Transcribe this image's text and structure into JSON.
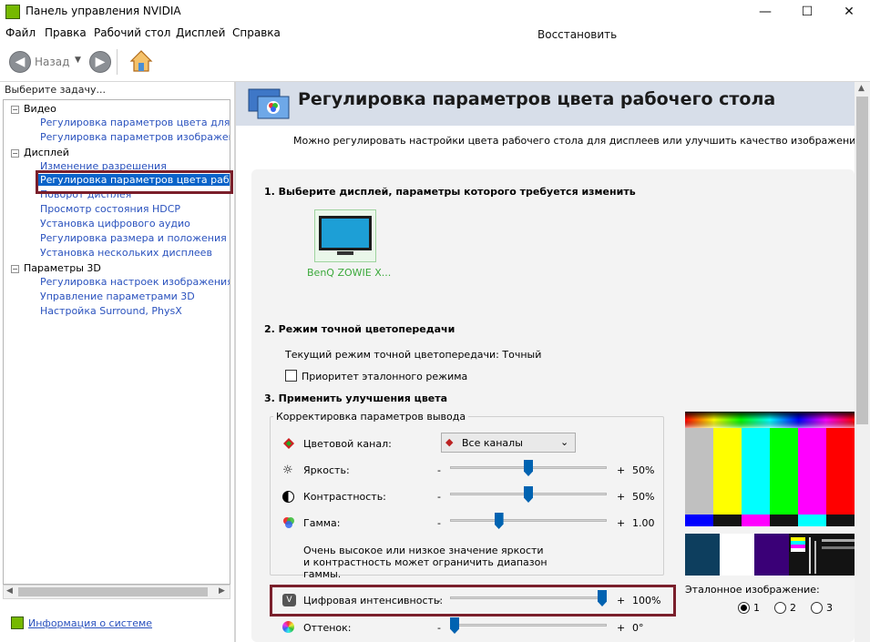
{
  "window": {
    "title": "Панель управления NVIDIA",
    "minimize": "—",
    "maximize": "☐",
    "close": "✕"
  },
  "menu": [
    "Файл",
    "Правка",
    "Рабочий стол",
    "Дисплей",
    "Справка"
  ],
  "toolbar": {
    "back_label": "Назад"
  },
  "left": {
    "header": "Выберите задачу...",
    "tree": {
      "video": {
        "label": "Видео",
        "items": [
          "Регулировка параметров цвета для вид",
          "Регулировка параметров изображения д"
        ]
      },
      "display": {
        "label": "Дисплей",
        "items": [
          "Изменение разрешения",
          "Регулировка параметров цвета рабочег",
          "Поворот дисплея",
          "Просмотр состояния HDCP",
          "Установка цифрового аудио",
          "Регулировка размера и положения рабо",
          "Установка нескольких дисплеев"
        ]
      },
      "p3d": {
        "label": "Параметры 3D",
        "items": [
          "Регулировка настроек изображения с пр",
          "Управление параметрами 3D",
          "Настройка Surround, PhysX"
        ]
      }
    },
    "system_info": "Информация о системе"
  },
  "page": {
    "title": "Регулировка параметров цвета рабочего стола",
    "restore": "Восстановить",
    "description": "Можно регулировать настройки цвета рабочего стола для дисплеев или улучшить качество изображения, если использу",
    "section1": "1. Выберите дисплей, параметры которого требуется изменить",
    "display_name": "BenQ ZOWIE X...",
    "section2": "2. Режим точной цветопередачи",
    "current_mode": "Текущий режим точной цветопередачи: Точный",
    "priority_ref": "Приоритет эталонного режима",
    "section3": "3. Применить улучшения цвета",
    "group_label": "Корректировка параметров вывода",
    "channel_label": "Цветовой канал:",
    "channel_value": "Все каналы",
    "sliders": [
      {
        "label": "Яркость:",
        "minus": "-",
        "plus": "+",
        "value": "50%",
        "level": 0.5
      },
      {
        "label": "Контрастность:",
        "minus": "-",
        "plus": "+",
        "value": "50%",
        "level": 0.5
      },
      {
        "label": "Гамма:",
        "minus": "-",
        "plus": "+",
        "value": "1.00",
        "level": 0.3
      }
    ],
    "note": "Очень высокое или низкое значение яркости и контрастность может ограничить диапазон гаммы.",
    "digital": {
      "label": "Цифровая интенсивность:",
      "minus": "-",
      "plus": "+",
      "value": "100%",
      "level": 1.0
    },
    "hue": {
      "label": "Оттенок:",
      "minus": "-",
      "plus": "+",
      "value": "0°",
      "level": 0.0
    },
    "ref_image_label": "Эталонное изображение:",
    "ref_options": [
      "1",
      "2",
      "3"
    ]
  },
  "colors": {
    "nvidia_green": "#76b900",
    "header_bg": "#d7dee9",
    "link": "#2a52be",
    "highlight": "#7a1f2b",
    "slider": "#0063b1"
  }
}
